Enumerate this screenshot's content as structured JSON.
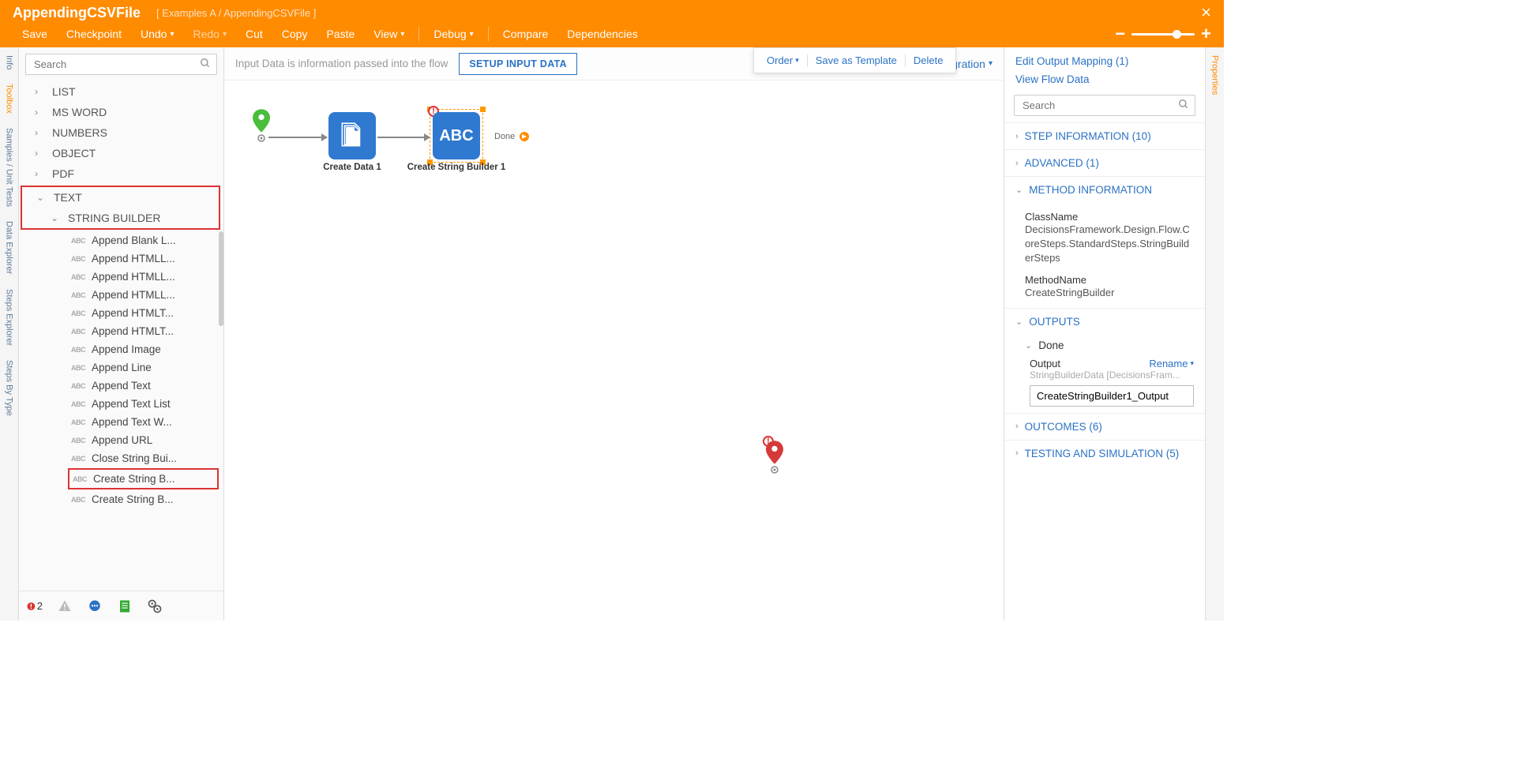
{
  "header": {
    "title": "AppendingCSVFile",
    "breadcrumb": "[ Examples A / AppendingCSVFile ]"
  },
  "menu": {
    "save": "Save",
    "checkpoint": "Checkpoint",
    "undo": "Undo",
    "redo": "Redo",
    "cut": "Cut",
    "copy": "Copy",
    "paste": "Paste",
    "view": "View",
    "debug": "Debug",
    "compare": "Compare",
    "dependencies": "Dependencies"
  },
  "left_tabs": [
    "Info",
    "Toolbox",
    "Samples / Unit Tests",
    "Data Explorer",
    "Steps Explorer",
    "Steps By Type"
  ],
  "right_tabs": [
    "Properties"
  ],
  "toolbox_search_placeholder": "Search",
  "tree": {
    "groups": [
      "LIST",
      "MS WORD",
      "NUMBERS",
      "OBJECT",
      "PDF",
      "TEXT"
    ],
    "sub": "STRING BUILDER",
    "leaves": [
      "Append Blank L...",
      "Append HTMLL...",
      "Append HTMLL...",
      "Append HTMLL...",
      "Append HTMLT...",
      "Append HTMLT...",
      "Append Image",
      "Append Line",
      "Append Text",
      "Append Text List",
      "Append Text W...",
      "Append URL",
      "Close String Bui...",
      "Create String B...",
      "Create String B..."
    ]
  },
  "status_error_count": "2",
  "canvas": {
    "hint": "Input Data is information passed into the flow",
    "setup_btn": "SETUP INPUT DATA",
    "config_link": "Configure Integration",
    "ctx": {
      "order": "Order",
      "save_tpl": "Save as Template",
      "delete": "Delete"
    },
    "nodes": {
      "create_data": "Create Data 1",
      "string_builder": "Create String Builder 1",
      "done": "Done"
    }
  },
  "props": {
    "edit_mapping": "Edit Output Mapping (1)",
    "view_flow": "View Flow Data",
    "search_placeholder": "Search",
    "sections": {
      "step_info": "STEP INFORMATION (10)",
      "advanced": "ADVANCED (1)",
      "method_info": "METHOD INFORMATION",
      "outputs": "OUTPUTS",
      "outcomes": "OUTCOMES (6)",
      "testing": "TESTING AND SIMULATION (5)"
    },
    "method": {
      "cls_label": "ClassName",
      "cls_val": "DecisionsFramework.Design.Flow.CoreSteps.StandardSteps.StringBuilderSteps",
      "meth_label": "MethodName",
      "meth_val": "CreateStringBuilder"
    },
    "outputs": {
      "done": "Done",
      "output_label": "Output",
      "rename": "Rename",
      "type_hint": "StringBuilderData [DecisionsFram...",
      "output_value": "CreateStringBuilder1_Output"
    }
  }
}
